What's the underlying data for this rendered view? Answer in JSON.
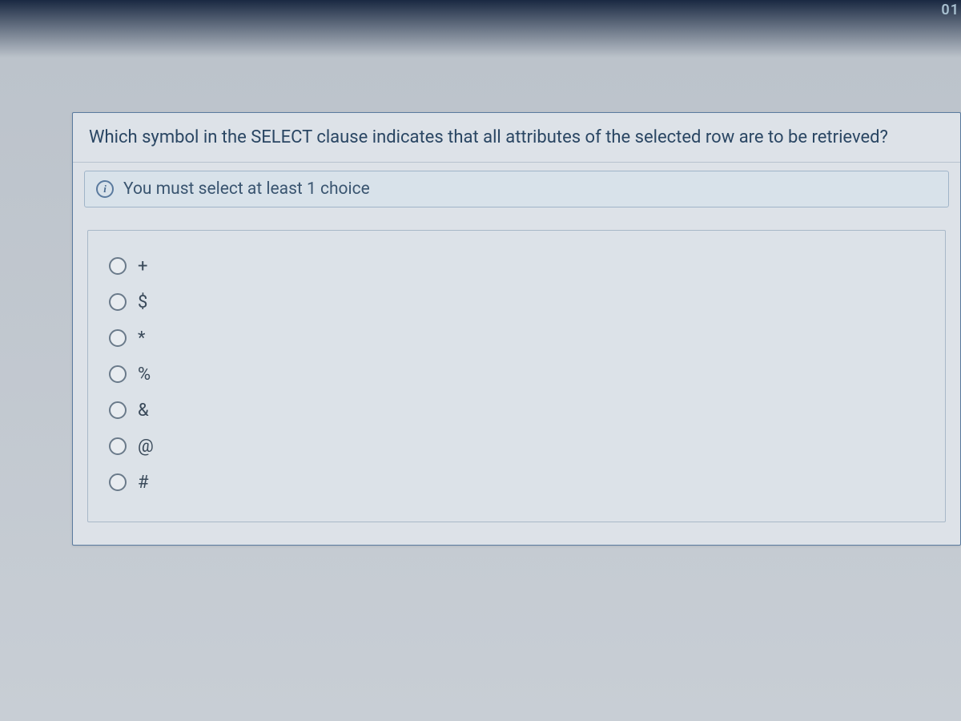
{
  "top_fragment": "01",
  "question": {
    "text": "Which symbol in the SELECT clause indicates that all attributes of the selected row are to be retrieved?",
    "hint": "You must select at least 1 choice"
  },
  "options": [
    {
      "label": "+"
    },
    {
      "label": "$"
    },
    {
      "label": "*"
    },
    {
      "label": "%"
    },
    {
      "label": "&"
    },
    {
      "label": "@"
    },
    {
      "label": "#"
    }
  ]
}
